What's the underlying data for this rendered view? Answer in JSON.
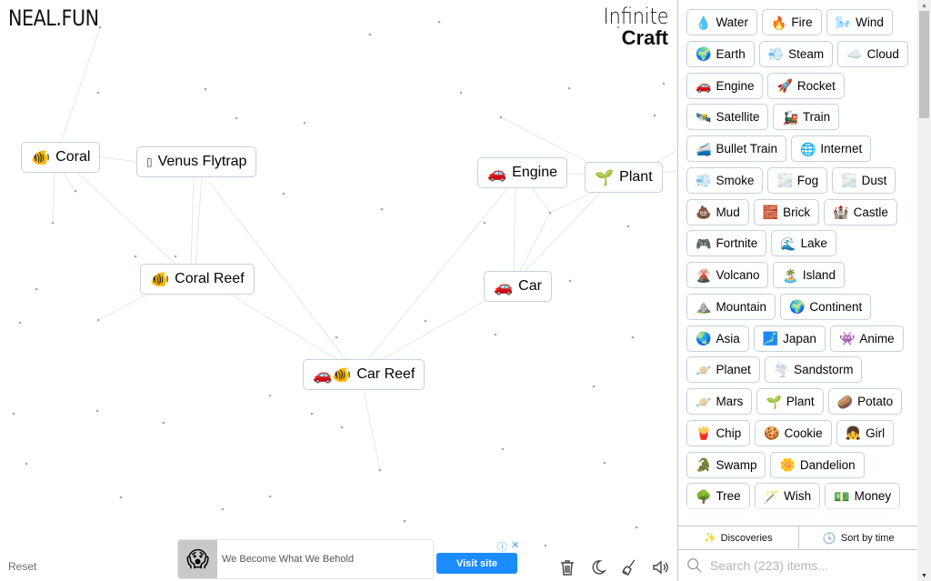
{
  "header": {
    "logo": "NEAL.FUN",
    "title_line1": "Infinite",
    "title_line2": "Craft"
  },
  "canvas": {
    "nodes": [
      {
        "id": "coral",
        "emoji": "🐠",
        "label": "Coral"
      },
      {
        "id": "venus-flytrap",
        "emoji": "▯",
        "label": "Venus Flytrap"
      },
      {
        "id": "coral-reef",
        "emoji": "🐠",
        "label": "Coral Reef"
      },
      {
        "id": "engine",
        "emoji": "🚗",
        "label": "Engine"
      },
      {
        "id": "plant",
        "emoji": "🌱",
        "label": "Plant"
      },
      {
        "id": "car",
        "emoji": "🚗",
        "label": "Car"
      },
      {
        "id": "car-reef",
        "emoji": "🚗🐠",
        "label": "Car Reef"
      }
    ],
    "reset_label": "Reset"
  },
  "ad": {
    "thumb_icon": "😱",
    "text": "We Become What We Behold",
    "cta": "Visit site",
    "info_icon": "ⓘ",
    "close_icon": "✕"
  },
  "tools": {
    "delete": "trash-icon",
    "theme": "moon-icon",
    "clear": "broom-icon",
    "sound": "speaker-icon"
  },
  "sidebar": {
    "rows": [
      [
        {
          "emoji": "💧",
          "label": "Water"
        },
        {
          "emoji": "🔥",
          "label": "Fire"
        },
        {
          "emoji": "🌬️",
          "label": "Wind"
        }
      ],
      [
        {
          "emoji": "🌍",
          "label": "Earth"
        },
        {
          "emoji": "💨",
          "label": "Steam"
        },
        {
          "emoji": "☁️",
          "label": "Cloud"
        }
      ],
      [
        {
          "emoji": "🚗",
          "label": "Engine"
        },
        {
          "emoji": "🚀",
          "label": "Rocket"
        }
      ],
      [
        {
          "emoji": "🛰️",
          "label": "Satellite"
        },
        {
          "emoji": "🚂",
          "label": "Train"
        }
      ],
      [
        {
          "emoji": "🚄",
          "label": "Bullet Train"
        },
        {
          "emoji": "🌐",
          "label": "Internet"
        }
      ],
      [
        {
          "emoji": "💨",
          "label": "Smoke"
        },
        {
          "emoji": "🌫️",
          "label": "Fog"
        },
        {
          "emoji": "🌫️",
          "label": "Dust"
        }
      ],
      [
        {
          "emoji": "💩",
          "label": "Mud"
        },
        {
          "emoji": "🧱",
          "label": "Brick"
        },
        {
          "emoji": "🏰",
          "label": "Castle"
        }
      ],
      [
        {
          "emoji": "🎮",
          "label": "Fortnite"
        },
        {
          "emoji": "🌊",
          "label": "Lake"
        }
      ],
      [
        {
          "emoji": "🌋",
          "label": "Volcano"
        },
        {
          "emoji": "🏝️",
          "label": "Island"
        }
      ],
      [
        {
          "emoji": "⛰️",
          "label": "Mountain"
        },
        {
          "emoji": "🌍",
          "label": "Continent"
        }
      ],
      [
        {
          "emoji": "🌏",
          "label": "Asia"
        },
        {
          "emoji": "🗾",
          "label": "Japan"
        },
        {
          "emoji": "👾",
          "label": "Anime"
        }
      ],
      [
        {
          "emoji": "🪐",
          "label": "Planet"
        },
        {
          "emoji": "🌪️",
          "label": "Sandstorm"
        }
      ],
      [
        {
          "emoji": "🪐",
          "label": "Mars"
        },
        {
          "emoji": "🌱",
          "label": "Plant"
        },
        {
          "emoji": "🥔",
          "label": "Potato"
        }
      ],
      [
        {
          "emoji": "🍟",
          "label": "Chip"
        },
        {
          "emoji": "🍪",
          "label": "Cookie"
        },
        {
          "emoji": "👧",
          "label": "Girl"
        }
      ],
      [
        {
          "emoji": "🐊",
          "label": "Swamp"
        },
        {
          "emoji": "🌼",
          "label": "Dandelion"
        }
      ],
      [
        {
          "emoji": "🌳",
          "label": "Tree"
        },
        {
          "emoji": "🪄",
          "label": "Wish"
        },
        {
          "emoji": "💵",
          "label": "Money"
        }
      ]
    ],
    "tabs": {
      "discoveries": "Discoveries",
      "sort": "Sort by time"
    },
    "search": {
      "placeholder": "Search (223) items...",
      "value": ""
    }
  }
}
